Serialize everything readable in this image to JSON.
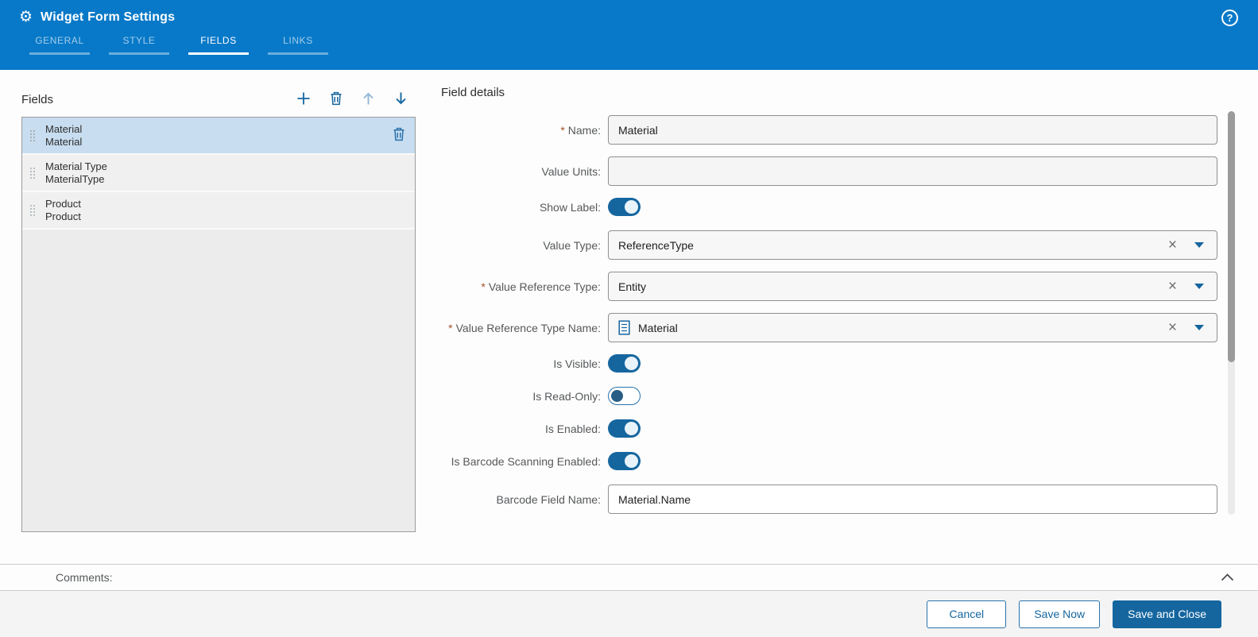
{
  "colors": {
    "header_blue": "#0879c8",
    "accent": "#15669f",
    "selected_row": "#c8ddf0",
    "row_gray": "#f0f0f0",
    "panel_bg": "#ececec",
    "footer_bg": "#f4f4f4"
  },
  "icons": {
    "gear": "⚙",
    "help": "?",
    "clear": "×"
  },
  "header": {
    "title": "Widget Form Settings",
    "active_tab": "FIELDS",
    "tabs": [
      {
        "label": "GENERAL"
      },
      {
        "label": "STYLE"
      },
      {
        "label": "FIELDS"
      },
      {
        "label": "LINKS"
      }
    ]
  },
  "fields_panel": {
    "title": "Fields",
    "selected_index": 0,
    "items": [
      {
        "label": "Material",
        "name": "Material"
      },
      {
        "label": "Material Type",
        "name": "MaterialType"
      },
      {
        "label": "Product",
        "name": "Product"
      }
    ]
  },
  "field_details": {
    "title": "Field details",
    "required_marker": "*",
    "name": {
      "label": "Name:",
      "value": "Material",
      "required": true
    },
    "value_units": {
      "label": "Value Units:",
      "value": ""
    },
    "show_label": {
      "label": "Show Label:",
      "on": true
    },
    "value_type": {
      "label": "Value Type:",
      "value": "ReferenceType"
    },
    "value_reference_type": {
      "label": "Value Reference Type:",
      "value": "Entity",
      "required": true
    },
    "value_reference_type_name": {
      "label": "Value Reference Type Name:",
      "value": "Material",
      "required": true
    },
    "is_visible": {
      "label": "Is Visible:",
      "on": true
    },
    "is_read_only": {
      "label": "Is Read-Only:",
      "on": false
    },
    "is_enabled": {
      "label": "Is Enabled:",
      "on": true
    },
    "is_barcode_scanning_enabled": {
      "label": "Is Barcode Scanning Enabled:",
      "on": true
    },
    "barcode_field_name": {
      "label": "Barcode Field Name:",
      "value": "Material.Name"
    }
  },
  "comments": {
    "label": "Comments:"
  },
  "footer": {
    "cancel": "Cancel",
    "save_now": "Save Now",
    "save_and_close": "Save and Close"
  }
}
